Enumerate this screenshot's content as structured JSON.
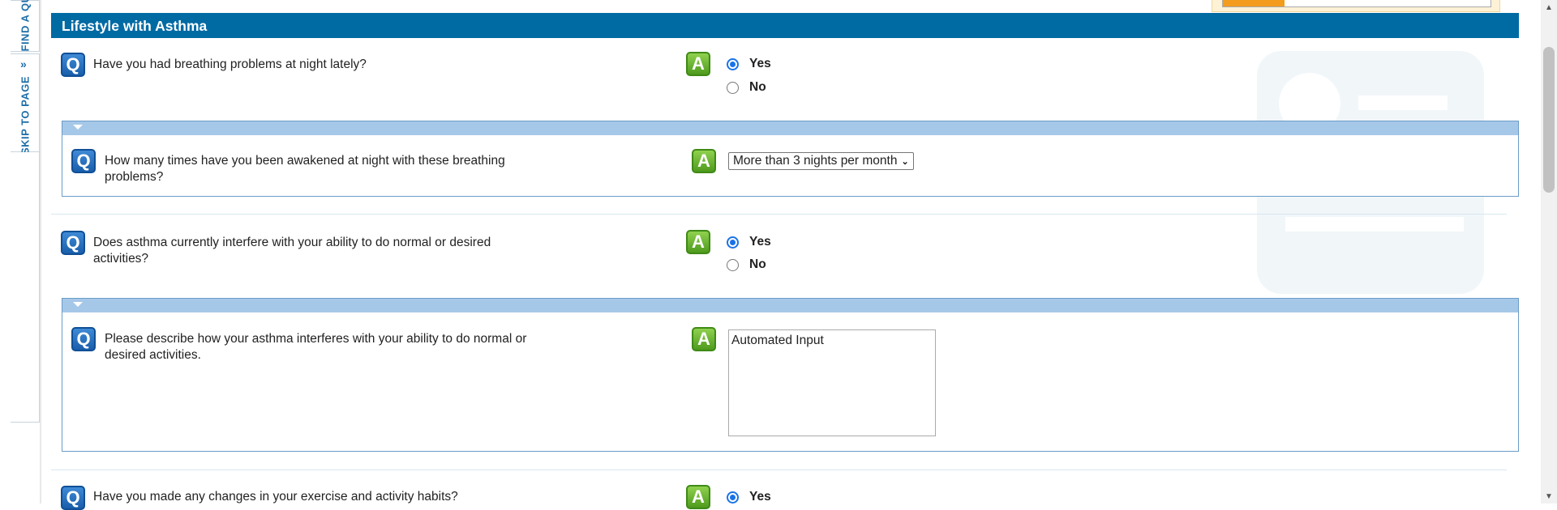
{
  "side_tabs": {
    "find": "FIND A QU",
    "skip": "SKIP TO PAGE"
  },
  "section": {
    "title": "Lifestyle with Asthma"
  },
  "progress": {
    "fraction": 0.23
  },
  "questions": [
    {
      "text": "Have you had breathing problems at night lately?",
      "options": [
        "Yes",
        "No"
      ],
      "selected": "Yes"
    },
    {
      "text_line1": "How many times have you been awakened at night with these breathing",
      "text_line2": "problems?",
      "selected_value": "More than 3 nights per month"
    },
    {
      "text_line1": "Does asthma currently interfere with your ability to do normal or desired",
      "text_line2": "activities?",
      "options": [
        "Yes",
        "No"
      ],
      "selected": "Yes"
    },
    {
      "text_line1": "Please describe how your asthma interferes with your ability to do normal or",
      "text_line2": "desired activities.",
      "value": "Automated Input"
    },
    {
      "text": "Have you made any changes in your exercise and activity habits?",
      "options": [
        "Yes"
      ],
      "selected": "Yes"
    }
  ],
  "icons": {
    "question": "Q",
    "answer": "A"
  }
}
